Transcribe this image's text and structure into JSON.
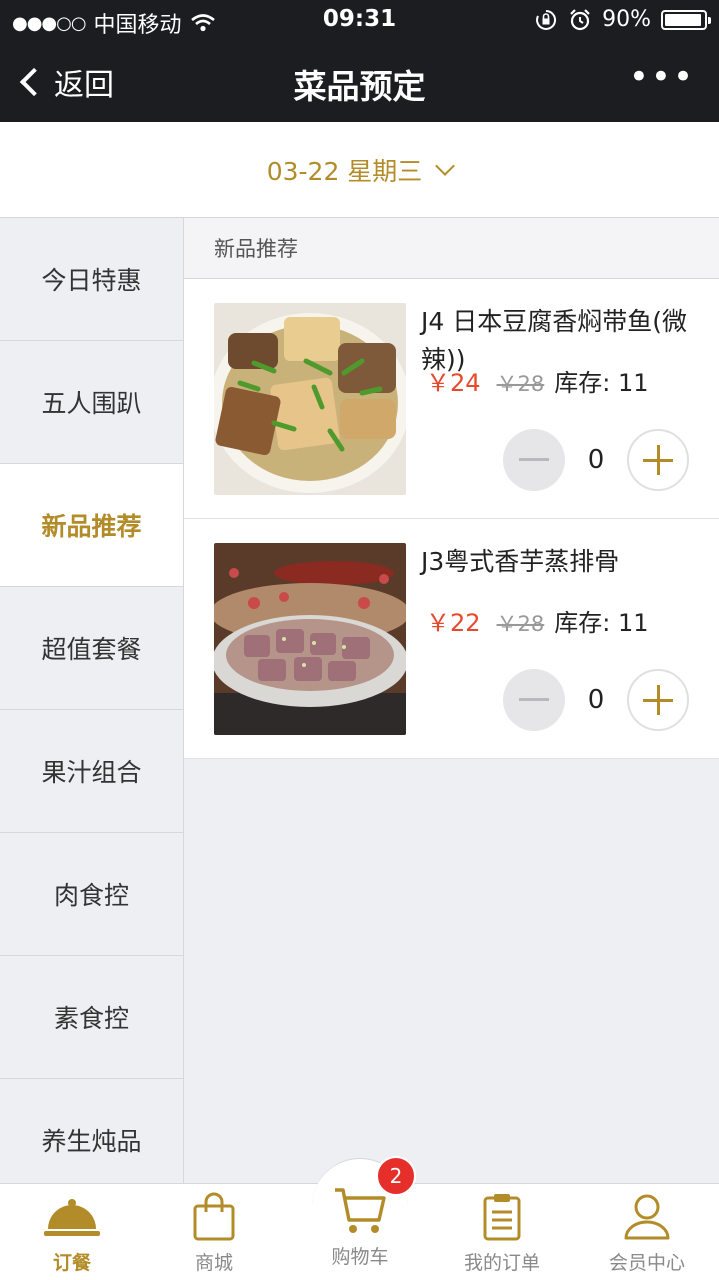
{
  "status_bar": {
    "carrier": "中国移动",
    "time": "09:31",
    "battery": "90%",
    "icons": [
      "signal-dots",
      "wifi-icon",
      "lock-rotation-icon",
      "alarm-icon",
      "battery-icon"
    ]
  },
  "nav": {
    "back_label": "返回",
    "title": "菜品预定",
    "more_label": "•••"
  },
  "date_selector": {
    "label": "03-22 星期三"
  },
  "sidebar": {
    "items": [
      {
        "label": "今日特惠"
      },
      {
        "label": "五人围趴"
      },
      {
        "label": "新品推荐"
      },
      {
        "label": "超值套餐"
      },
      {
        "label": "果汁组合"
      },
      {
        "label": "肉食控"
      },
      {
        "label": "素食控"
      },
      {
        "label": "养生炖品"
      }
    ],
    "active_index": 2
  },
  "section": {
    "title": "新品推荐"
  },
  "products": [
    {
      "name": "J4 日本豆腐香焖带鱼(微辣))",
      "price": "￥24",
      "old_price": "￥28",
      "stock": "库存: 11",
      "qty": "0"
    },
    {
      "name": "J3粤式香芋蒸排骨",
      "price": "￥22",
      "old_price": "￥28",
      "stock": "库存: 11",
      "qty": "0"
    }
  ],
  "tab_bar": {
    "tabs": [
      {
        "label": "订餐",
        "icon": "cloche-icon"
      },
      {
        "label": "商城",
        "icon": "shopping-bag-icon"
      },
      {
        "label": "购物车",
        "icon": "cart-icon"
      },
      {
        "label": "我的订单",
        "icon": "clipboard-icon"
      },
      {
        "label": "会员中心",
        "icon": "user-icon"
      }
    ],
    "active_index": 0,
    "cart_badge": "2"
  },
  "colors": {
    "accent": "#b38c2a",
    "price": "#e8492d",
    "header_bg": "#1c1d21",
    "badge": "#e62f2a"
  }
}
